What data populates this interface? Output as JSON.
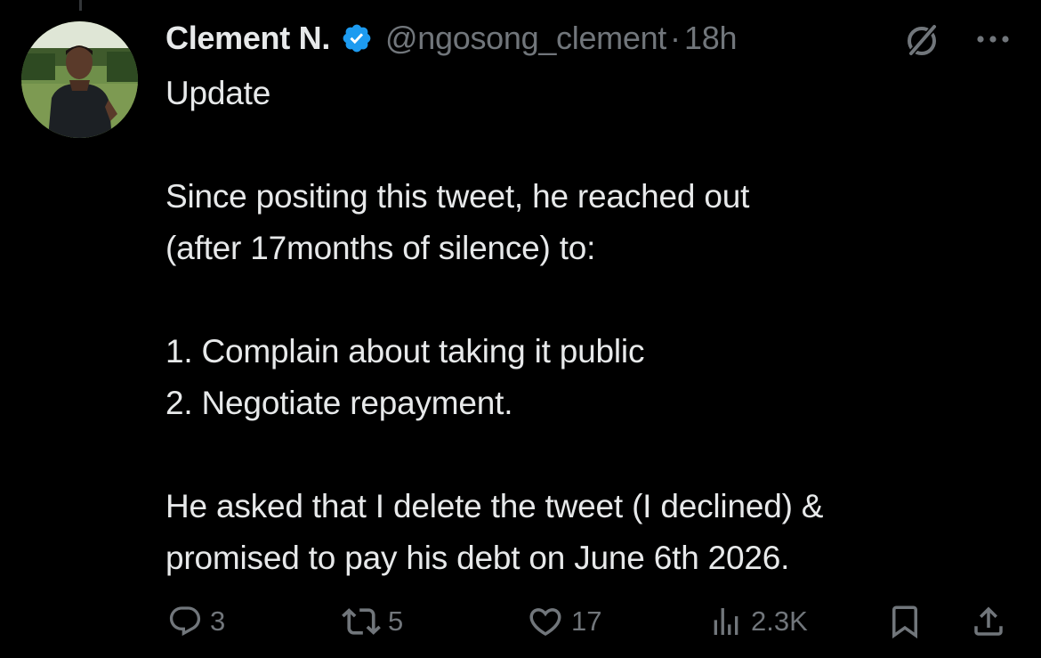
{
  "author": {
    "display_name": "Clement N.",
    "handle": "@ngosong_clement",
    "separator": "·",
    "time": "18h",
    "verified": true,
    "verified_color": "#1d9bf0"
  },
  "tweet": {
    "paragraphs": [
      "Update",
      "",
      "Since positing this tweet, he reached out",
      "(after 17months of silence) to:",
      "",
      "1. Complain about taking it public",
      "2. Negotiate repayment.",
      "",
      "He asked that I delete the tweet (I declined) &",
      "promised to pay his debt on June 6th 2026."
    ]
  },
  "actions": {
    "replies": "3",
    "reposts": "5",
    "likes": "17",
    "views": "2.3K"
  },
  "icons": {
    "verified": "verified-badge-icon",
    "grok": "grok-icon",
    "more": "more-icon",
    "reply": "reply-icon",
    "repost": "repost-icon",
    "like": "heart-icon",
    "views": "views-icon",
    "bookmark": "bookmark-icon",
    "share": "share-icon"
  },
  "colors": {
    "background": "#000000",
    "text": "#e7e9ea",
    "secondary": "#71767b"
  }
}
